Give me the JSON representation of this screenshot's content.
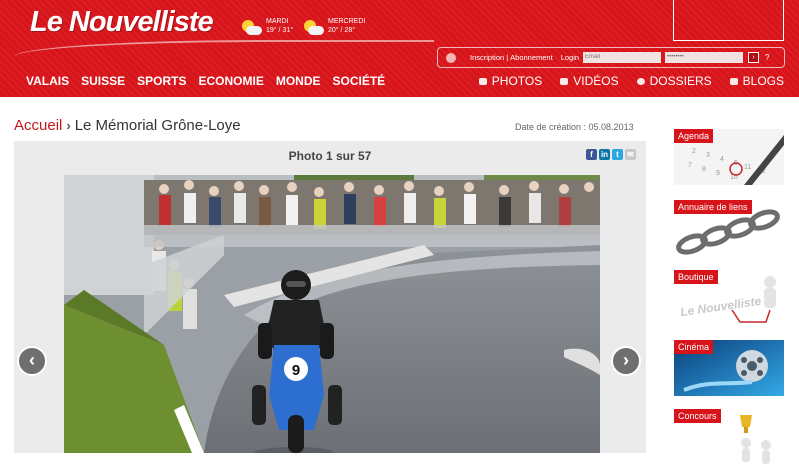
{
  "header": {
    "logo": "Le Nouvelliste",
    "weather": [
      {
        "day": "MARDI",
        "temp": "19° / 31°"
      },
      {
        "day": "MERCREDI",
        "temp": "20° / 28°"
      }
    ],
    "login": {
      "inscription": "Inscription",
      "separator": "|",
      "abonnement": "Abonnement",
      "login_label": "Login",
      "email_placeholder": "Email",
      "password_placeholder": "••••••••",
      "help": "?"
    }
  },
  "nav": {
    "left": [
      "VALAIS",
      "SUISSE",
      "SPORTS",
      "ECONOMIE",
      "MONDE",
      "SOCIÉTÉ"
    ],
    "right": [
      "PHOTOS",
      "VIDÉOS",
      "DOSSIERS",
      "BLOGS"
    ]
  },
  "breadcrumb": {
    "home": "Accueil",
    "title": "Le Mémorial Grône-Loye"
  },
  "created": "Date de création : 05.08.2013",
  "gallery": {
    "counter": "Photo 1 sur 57",
    "rider_number": "9"
  },
  "sidebar": [
    {
      "tag": "Agenda"
    },
    {
      "tag": "Annuaire de liens"
    },
    {
      "tag": "Boutique",
      "image_text": "Le Nouvelliste"
    },
    {
      "tag": "Cinéma"
    },
    {
      "tag": "Concours"
    }
  ],
  "colors": {
    "brand_red": "#d7141a",
    "link_red": "#c4161c"
  }
}
